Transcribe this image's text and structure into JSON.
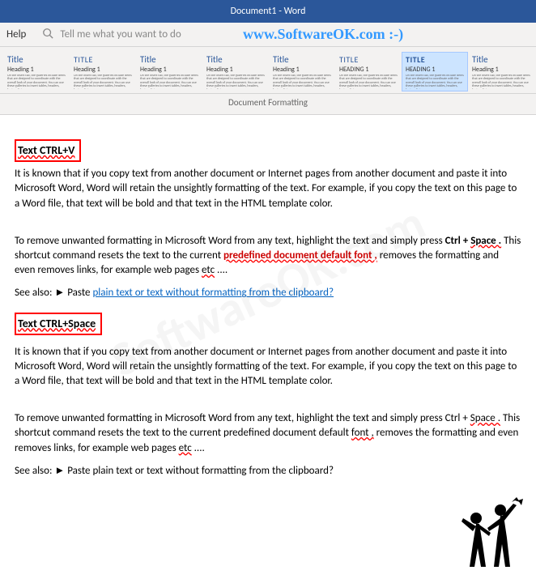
{
  "title_bar": "Document1  -  Word",
  "watermark_url": "www.SoftwareOK.com :-)",
  "help_row": {
    "help_label": "Help",
    "tell_me_placeholder": "Tell me what you want to do"
  },
  "styles": [
    {
      "title": "Title",
      "heading": "Heading 1",
      "selected": false,
      "titleClass": ""
    },
    {
      "title": "TITLE",
      "heading": "Heading 1",
      "selected": false,
      "titleClass": "caps"
    },
    {
      "title": "Title",
      "heading": "Heading 1",
      "selected": false,
      "titleClass": ""
    },
    {
      "title": "Title",
      "heading": "Heading 1",
      "selected": false,
      "titleClass": ""
    },
    {
      "title": "Title",
      "heading": "Heading 1",
      "selected": false,
      "titleClass": ""
    },
    {
      "title": "TITLE",
      "heading": "HEADING 1",
      "selected": false,
      "titleClass": "caps"
    },
    {
      "title": "TITLE",
      "heading": "HEADING 1",
      "selected": true,
      "titleClass": "caps t5"
    },
    {
      "title": "Title",
      "heading": "Heading 1",
      "selected": false,
      "titleClass": ""
    }
  ],
  "style_body_filler": "On the Insert tab, the galleries include items that are designed to coordinate with the overall look of your document. You can use these galleries to insert tables, headers, footers, lists, cover pages.",
  "gallery_label": "Document Formatting",
  "doc": {
    "heading1": "Text CTRL+V",
    "para1": "It is known that if you copy text from another document or Internet pages from another document and paste it into Microsoft Word, Word will retain the unsightly formatting of the text. For example, if you copy the text on this page to a Word file, that text will be bold and that text in the HTML template color.",
    "para2_a": "To remove unwanted formatting in Microsoft Word from any text, highlight the text and simply press ",
    "para2_b": "Ctrl + ",
    "para2_c": "Space .",
    "para2_d": " This shortcut command resets the text to the current ",
    "para2_e": "predefined document default font ,",
    "para2_f": " removes the formatting and even removes links, for example web pages ",
    "para2_g": "etc",
    "para2_h": " ....",
    "see_also1_prefix": "See also: ► Paste  ",
    "see_also1_link": "plain text or text without formatting from the clipboard?",
    "heading2": "Text CTRL+Space",
    "para3": "It is known that if you copy text from another document or Internet pages from another document and paste it into Microsoft Word, Word will retain the unsightly formatting of the text. For example, if you copy the text on this page to a Word file, that text will be bold and that text in the HTML template color.",
    "para4_a": "To remove unwanted formatting in Microsoft Word from any text, highlight the text and simply press Ctrl + ",
    "para4_b": "Space .",
    "para4_c": " This shortcut command resets the text to the current predefined document default ",
    "para4_d": "font ,",
    "para4_e": " removes the formatting and even removes links, for example web pages ",
    "para4_f": "etc",
    "para4_g": " ....",
    "see_also2": "See also: ► Paste  plain text or text without formatting from the clipboard?"
  }
}
